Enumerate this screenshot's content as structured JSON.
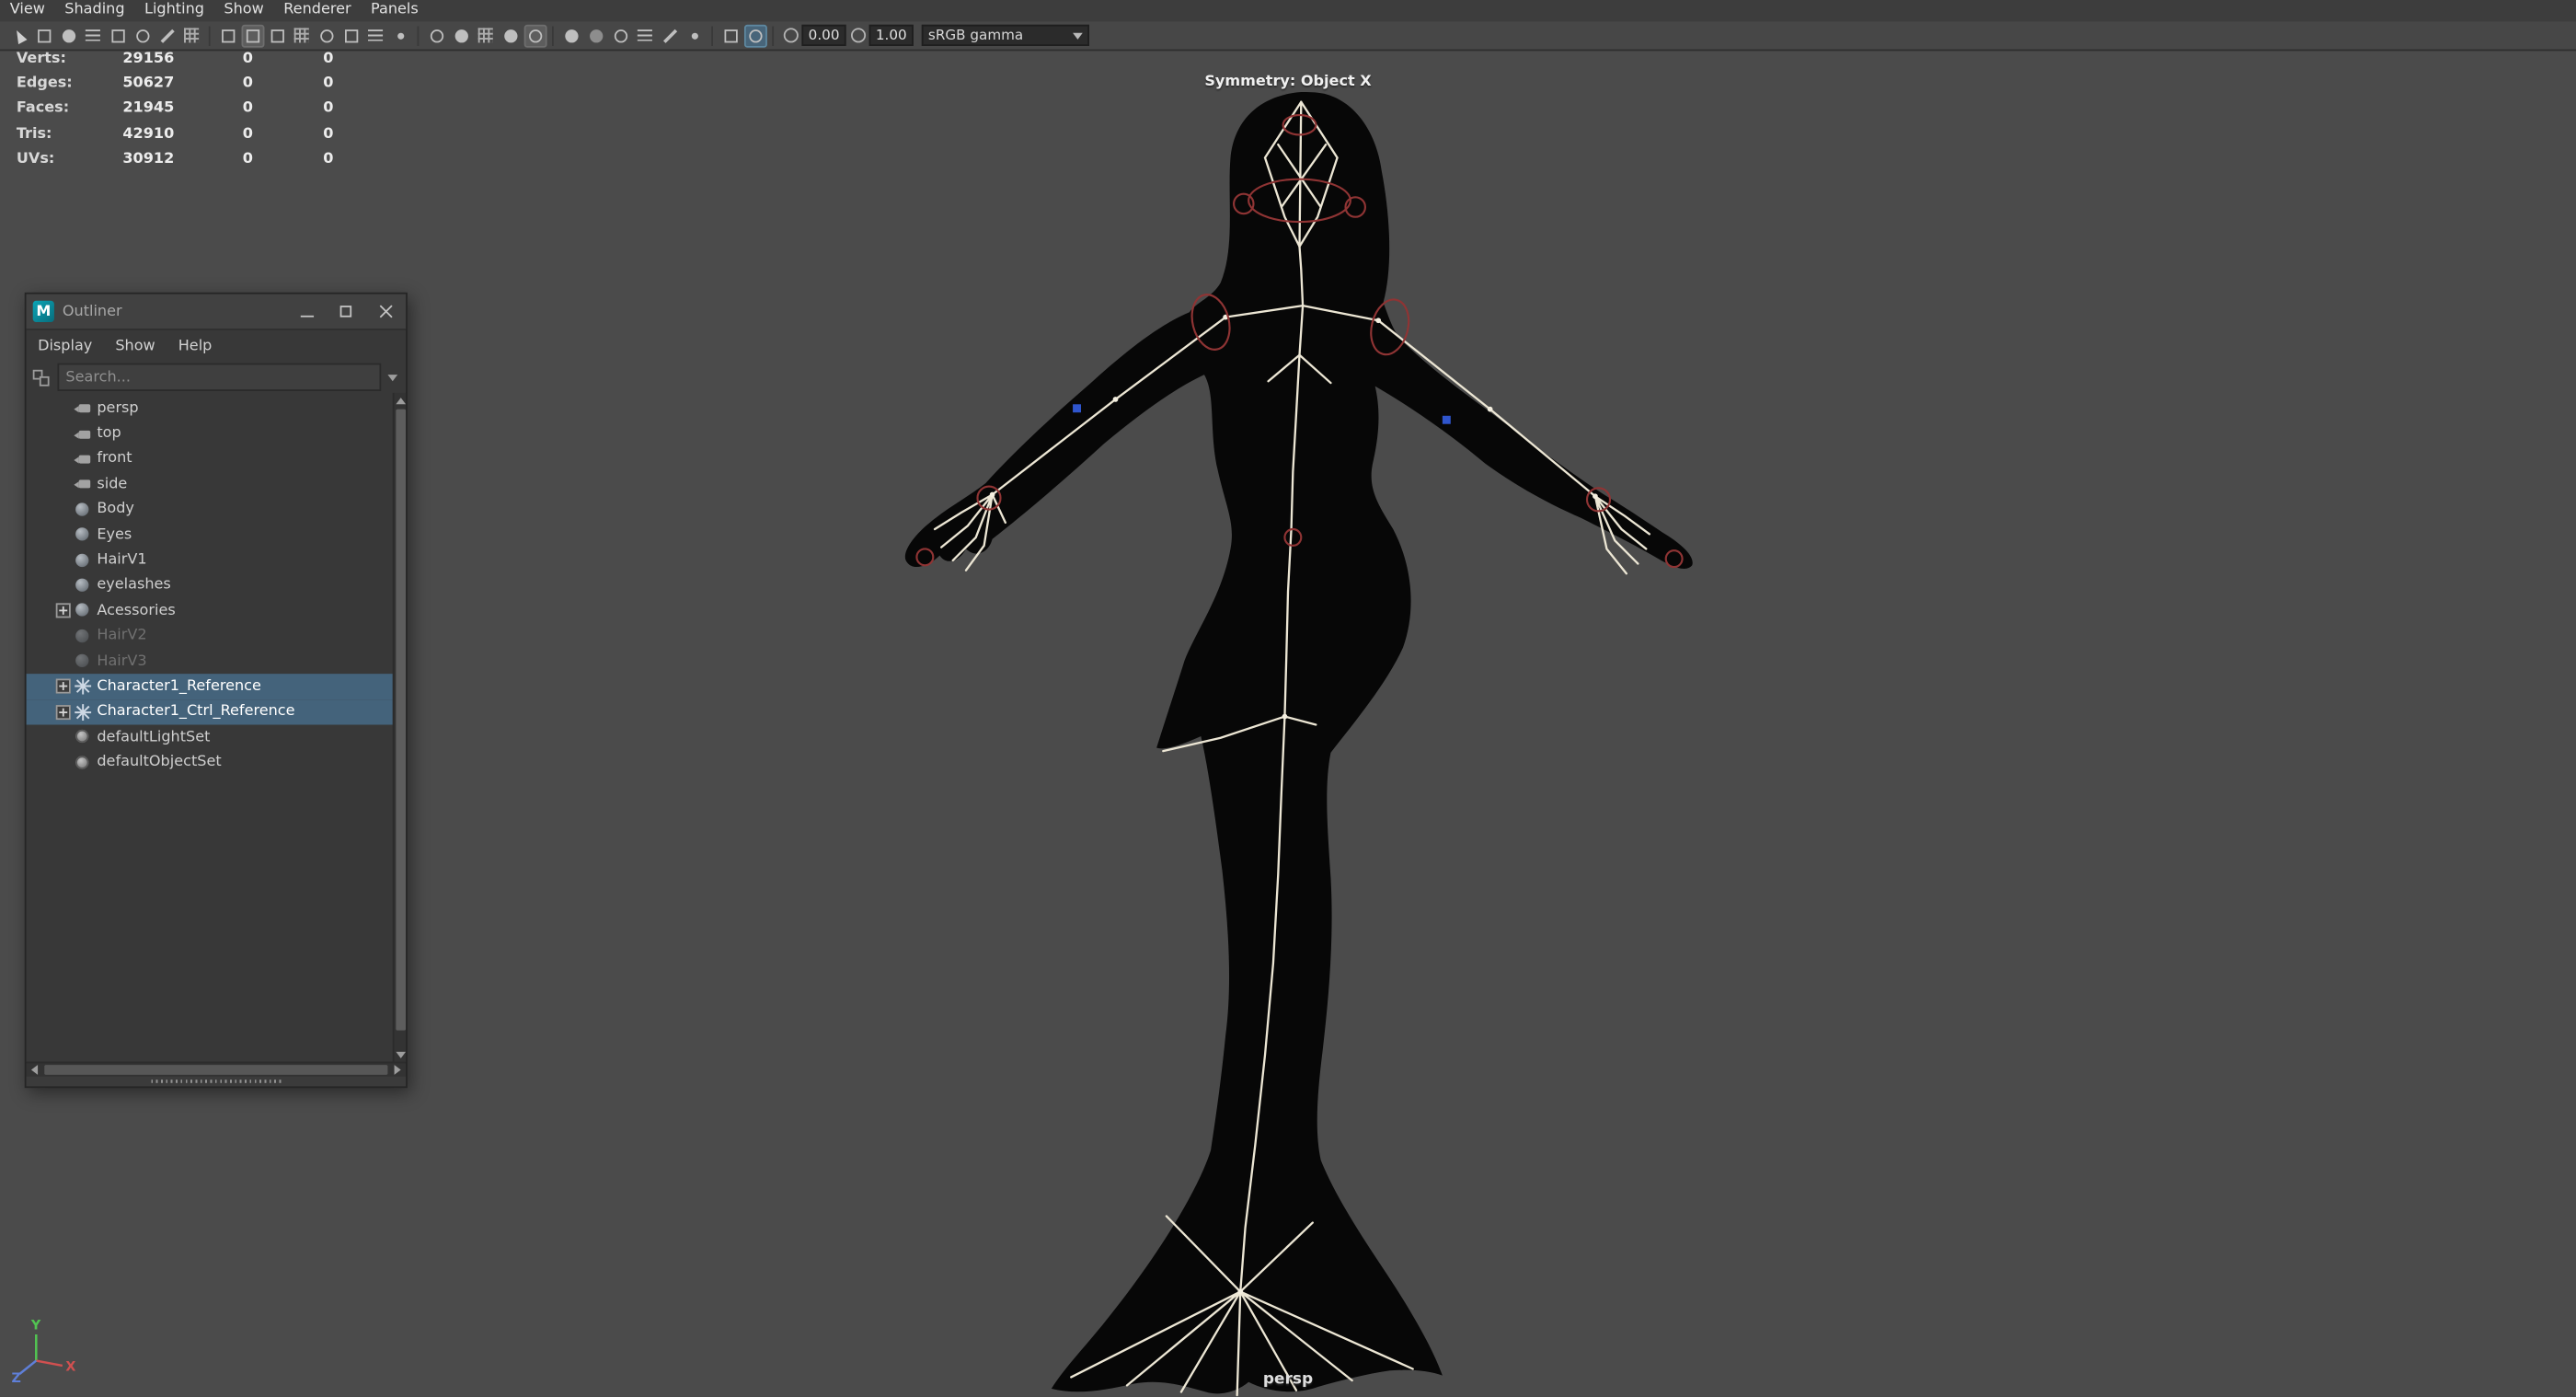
{
  "menu_bar": {
    "items": [
      "View",
      "Shading",
      "Lighting",
      "Show",
      "Renderer",
      "Panels"
    ]
  },
  "toolbar": {
    "icons": [
      "select-camera",
      "lock-camera",
      "camera-attributes",
      "bookmarks",
      "image-plane",
      "2d-pan-zoom",
      "grease-pencil",
      "grid",
      "film-gate",
      "resolution-gate",
      "gate-mask",
      "field-chart",
      "safe-action",
      "safe-title",
      "frame-all",
      "frame-selection",
      "wireframe",
      "shaded",
      "textured",
      "use-default-material",
      "wireframe-on-shaded",
      "use-all-lights",
      "shadows",
      "screen-space-ao",
      "motion-blur",
      "anti-aliasing",
      "depth-of-field",
      "isolate-select",
      "x-ray"
    ],
    "exposure_value": "0.00",
    "gamma_value": "1.00",
    "view_transform": "sRGB gamma"
  },
  "hud": {
    "symmetry_label": "Symmetry: Object X",
    "camera_label": "persp",
    "poly_count": {
      "rows": [
        {
          "label": "Verts:",
          "total": "29156",
          "sel1": "0",
          "sel2": "0"
        },
        {
          "label": "Edges:",
          "total": "50627",
          "sel1": "0",
          "sel2": "0"
        },
        {
          "label": "Faces:",
          "total": "21945",
          "sel1": "0",
          "sel2": "0"
        },
        {
          "label": "Tris:",
          "total": "42910",
          "sel1": "0",
          "sel2": "0"
        },
        {
          "label": "UVs:",
          "total": "30912",
          "sel1": "0",
          "sel2": "0"
        }
      ]
    }
  },
  "outliner": {
    "title": "Outliner",
    "logo": "M",
    "menus": [
      "Display",
      "Show",
      "Help"
    ],
    "search_placeholder": "Search...",
    "window_buttons": [
      "minimize",
      "maximize",
      "close"
    ],
    "items": [
      {
        "label": "persp",
        "icon": "camera"
      },
      {
        "label": "top",
        "icon": "camera"
      },
      {
        "label": "front",
        "icon": "camera"
      },
      {
        "label": "side",
        "icon": "camera"
      },
      {
        "label": "Body",
        "icon": "mesh"
      },
      {
        "label": "Eyes",
        "icon": "mesh"
      },
      {
        "label": "HairV1",
        "icon": "mesh"
      },
      {
        "label": "eyelashes",
        "icon": "mesh"
      },
      {
        "label": "Acessories",
        "icon": "mesh",
        "expandable": true
      },
      {
        "label": "HairV2",
        "icon": "mesh",
        "state": "hidden"
      },
      {
        "label": "HairV3",
        "icon": "mesh",
        "state": "hidden"
      },
      {
        "label": "Character1_Reference",
        "icon": "reference",
        "expandable": true,
        "state": "selected"
      },
      {
        "label": "Character1_Ctrl_Reference",
        "icon": "reference",
        "expandable": true,
        "state": "selected"
      },
      {
        "label": "defaultLightSet",
        "icon": "set"
      },
      {
        "label": "defaultObjectSet",
        "icon": "set"
      }
    ]
  },
  "axis_gizmo": {
    "x": "X",
    "y": "Y",
    "z": "Z"
  },
  "colors": {
    "selection_bg": "#44637b",
    "viewport_bg": "#4b4b4b",
    "accent_teal": "#0a8fa0",
    "control_red": "#8f3434",
    "joint_blue": "#2f55cc",
    "bone_white": "#ece6d4"
  }
}
